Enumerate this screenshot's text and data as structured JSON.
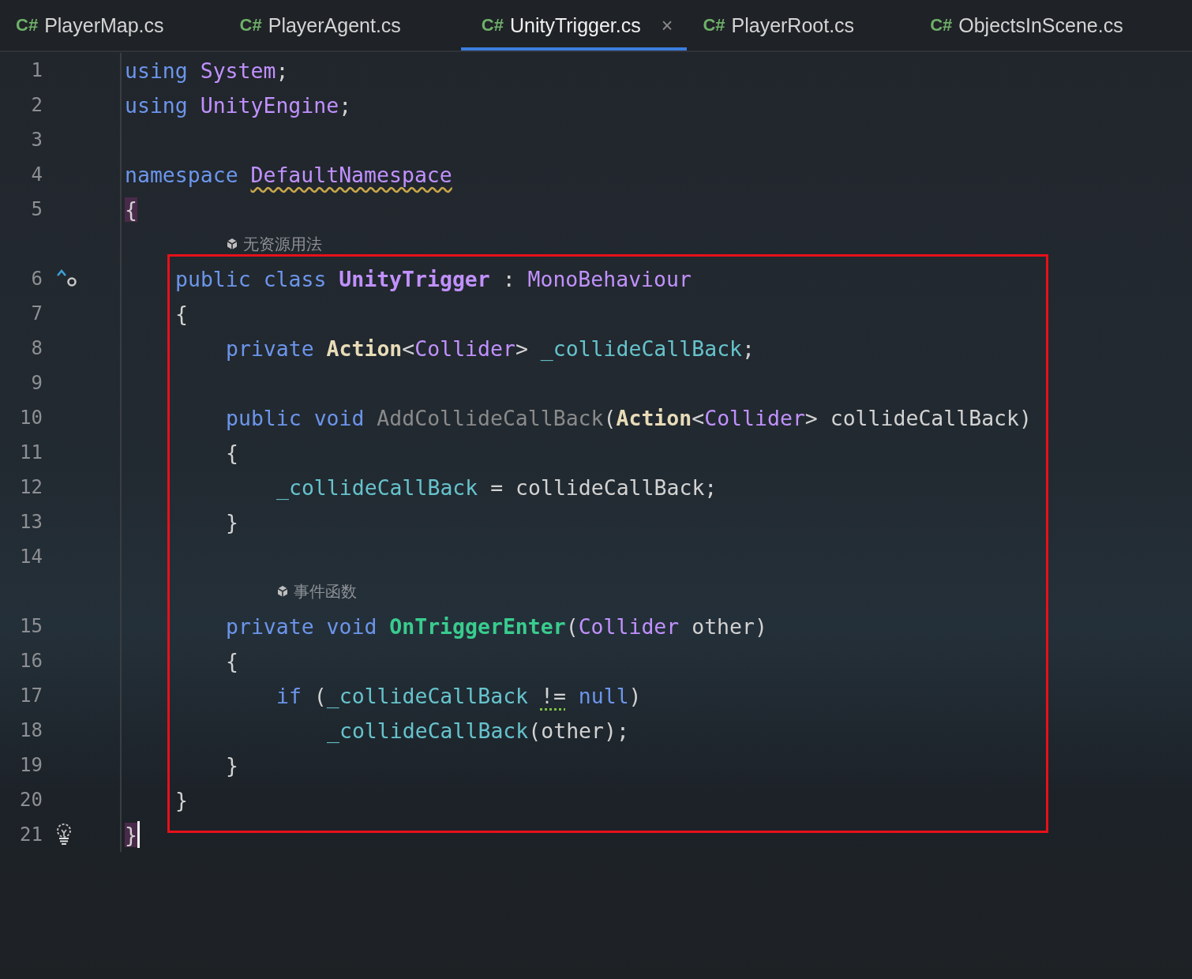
{
  "tabs": [
    {
      "lang": "C#",
      "label": "PlayerMap.cs",
      "selected": false
    },
    {
      "lang": "C#",
      "label": "PlayerAgent.cs",
      "selected": false
    },
    {
      "lang": "C#",
      "label": "UnityTrigger.cs",
      "selected": true,
      "close": "×"
    },
    {
      "lang": "C#",
      "label": "PlayerRoot.cs",
      "selected": false
    },
    {
      "lang": "C#",
      "label": "ObjectsInScene.cs",
      "selected": false
    }
  ],
  "editor": {
    "lines": [
      {
        "kind": "code",
        "number": "1",
        "boxed": false,
        "tokens": [
          {
            "kind": "kw",
            "text": "using"
          },
          {
            "kind": "type",
            "text": "System"
          },
          {
            "kind": "semi",
            "text": ";"
          }
        ]
      },
      {
        "kind": "code",
        "number": "2",
        "boxed": false,
        "tokens": [
          {
            "kind": "kw",
            "text": "using"
          },
          {
            "kind": "type",
            "text": "UnityEngine"
          },
          {
            "kind": "semi",
            "text": ";"
          }
        ]
      },
      {
        "kind": "code",
        "number": "3",
        "boxed": false
      },
      {
        "kind": "code",
        "number": "4",
        "boxed": false,
        "tokens": [
          {
            "kind": "kw",
            "text": "namespace"
          },
          {
            "kind": "ns",
            "text": "DefaultNamespace"
          }
        ]
      },
      {
        "kind": "code",
        "number": "5",
        "boxed": false,
        "tokens": [
          {
            "kind": "brace",
            "text": "{"
          }
        ],
        "children": [
          {
            "kind": "hint",
            "text": "无资源用法"
          },
          {
            "kind": "code",
            "number": "6",
            "boxed": true,
            "marker": {
              "kind": "implements"
            },
            "tokens": [
              {
                "kind": "kw",
                "text": "public"
              },
              {
                "kind": "kw",
                "text": "class"
              },
              {
                "kind": "cls",
                "text": "UnityTrigger"
              },
              {
                "kind": "plain",
                "text": ":"
              },
              {
                "kind": "type",
                "text": "MonoBehaviour"
              }
            ]
          },
          {
            "kind": "code",
            "number": "7",
            "boxed": true,
            "tokens": [
              {
                "kind": "plain",
                "text": "{"
              }
            ],
            "children": [
              {
                "kind": "code",
                "number": "8",
                "boxed": true,
                "tokens": [
                  {
                    "kind": "kw",
                    "text": "private"
                  },
                  {
                    "kind": "delegate",
                    "text": "Action"
                  },
                  {
                    "kind": "punct",
                    "text": "<"
                  },
                  {
                    "kind": "type",
                    "text": "Collider"
                  },
                  {
                    "kind": "punct",
                    "text": ">"
                  },
                  {
                    "kind": "field",
                    "text": "_collideCallBack"
                  },
                  {
                    "kind": "semi",
                    "text": ";"
                  }
                ]
              },
              {
                "kind": "code",
                "number": "9",
                "boxed": true
              },
              {
                "kind": "code",
                "number": "10",
                "boxed": true,
                "tokens": [
                  {
                    "kind": "kw",
                    "text": "public"
                  },
                  {
                    "kind": "kw",
                    "text": "void"
                  },
                  {
                    "kind": "unused",
                    "text": "AddCollideCallBack"
                  },
                  {
                    "kind": "punct",
                    "text": "("
                  },
                  {
                    "kind": "delegate",
                    "text": "Action"
                  },
                  {
                    "kind": "punct",
                    "text": "<"
                  },
                  {
                    "kind": "type",
                    "text": "Collider"
                  },
                  {
                    "kind": "punct",
                    "text": ">"
                  },
                  {
                    "kind": "plain",
                    "text": "collideCallBack"
                  },
                  {
                    "kind": "punct",
                    "text": ")"
                  }
                ]
              },
              {
                "kind": "code",
                "number": "11",
                "boxed": true,
                "tokens": [
                  {
                    "kind": "plain",
                    "text": "{"
                  }
                ],
                "children": [
                  {
                    "kind": "code",
                    "number": "12",
                    "boxed": true,
                    "tokens": [
                      {
                        "kind": "field",
                        "text": "_collideCallBack"
                      },
                      {
                        "kind": "plain",
                        "text": "="
                      },
                      {
                        "kind": "plain",
                        "text": "collideCallBack"
                      },
                      {
                        "kind": "semi",
                        "text": ";"
                      }
                    ]
                  }
                ]
              },
              {
                "kind": "code",
                "number": "13",
                "boxed": true,
                "tokens": [
                  {
                    "kind": "plain",
                    "text": "}"
                  }
                ]
              },
              {
                "kind": "code",
                "number": "14",
                "boxed": true
              },
              {
                "kind": "hint",
                "text": "事件函数"
              },
              {
                "kind": "code",
                "number": "15",
                "boxed": true,
                "tokens": [
                  {
                    "kind": "kw",
                    "text": "private"
                  },
                  {
                    "kind": "kw",
                    "text": "void"
                  },
                  {
                    "kind": "event",
                    "text": "OnTriggerEnter"
                  },
                  {
                    "kind": "punct",
                    "text": "("
                  },
                  {
                    "kind": "type",
                    "text": "Collider"
                  },
                  {
                    "kind": "plain",
                    "text": "other"
                  },
                  {
                    "kind": "punct",
                    "text": ")"
                  }
                ]
              },
              {
                "kind": "code",
                "number": "16",
                "boxed": true,
                "tokens": [
                  {
                    "kind": "plain",
                    "text": "{"
                  }
                ],
                "children": [
                  {
                    "kind": "code",
                    "number": "17",
                    "boxed": true,
                    "tokens": [
                      {
                        "kind": "kw",
                        "text": "if"
                      },
                      {
                        "kind": "punct",
                        "text": "("
                      },
                      {
                        "kind": "field",
                        "text": "_collideCallBack"
                      },
                      {
                        "kind": "suggest",
                        "text": "!="
                      },
                      {
                        "kind": "kw",
                        "text": "null"
                      },
                      {
                        "kind": "punct",
                        "text": ")"
                      }
                    ],
                    "children": [
                      {
                        "kind": "code",
                        "number": "18",
                        "boxed": true,
                        "tokens": [
                          {
                            "kind": "field",
                            "text": "_collideCallBack"
                          },
                          {
                            "kind": "punct",
                            "text": "("
                          },
                          {
                            "kind": "plain",
                            "text": "other"
                          },
                          {
                            "kind": "punct",
                            "text": ")"
                          },
                          {
                            "kind": "semi",
                            "text": ";"
                          }
                        ]
                      }
                    ]
                  }
                ]
              },
              {
                "kind": "code",
                "number": "19",
                "boxed": true,
                "tokens": [
                  {
                    "kind": "plain",
                    "text": "}"
                  }
                ]
              }
            ]
          },
          {
            "kind": "code",
            "number": "20",
            "boxed": true,
            "tokens": [
              {
                "kind": "plain",
                "text": "}"
              }
            ]
          }
        ]
      },
      {
        "kind": "code",
        "number": "21",
        "boxed": false,
        "marker": {
          "kind": "bulb"
        },
        "caret": true,
        "tokens": [
          {
            "kind": "brace",
            "text": "}"
          }
        ]
      }
    ]
  }
}
